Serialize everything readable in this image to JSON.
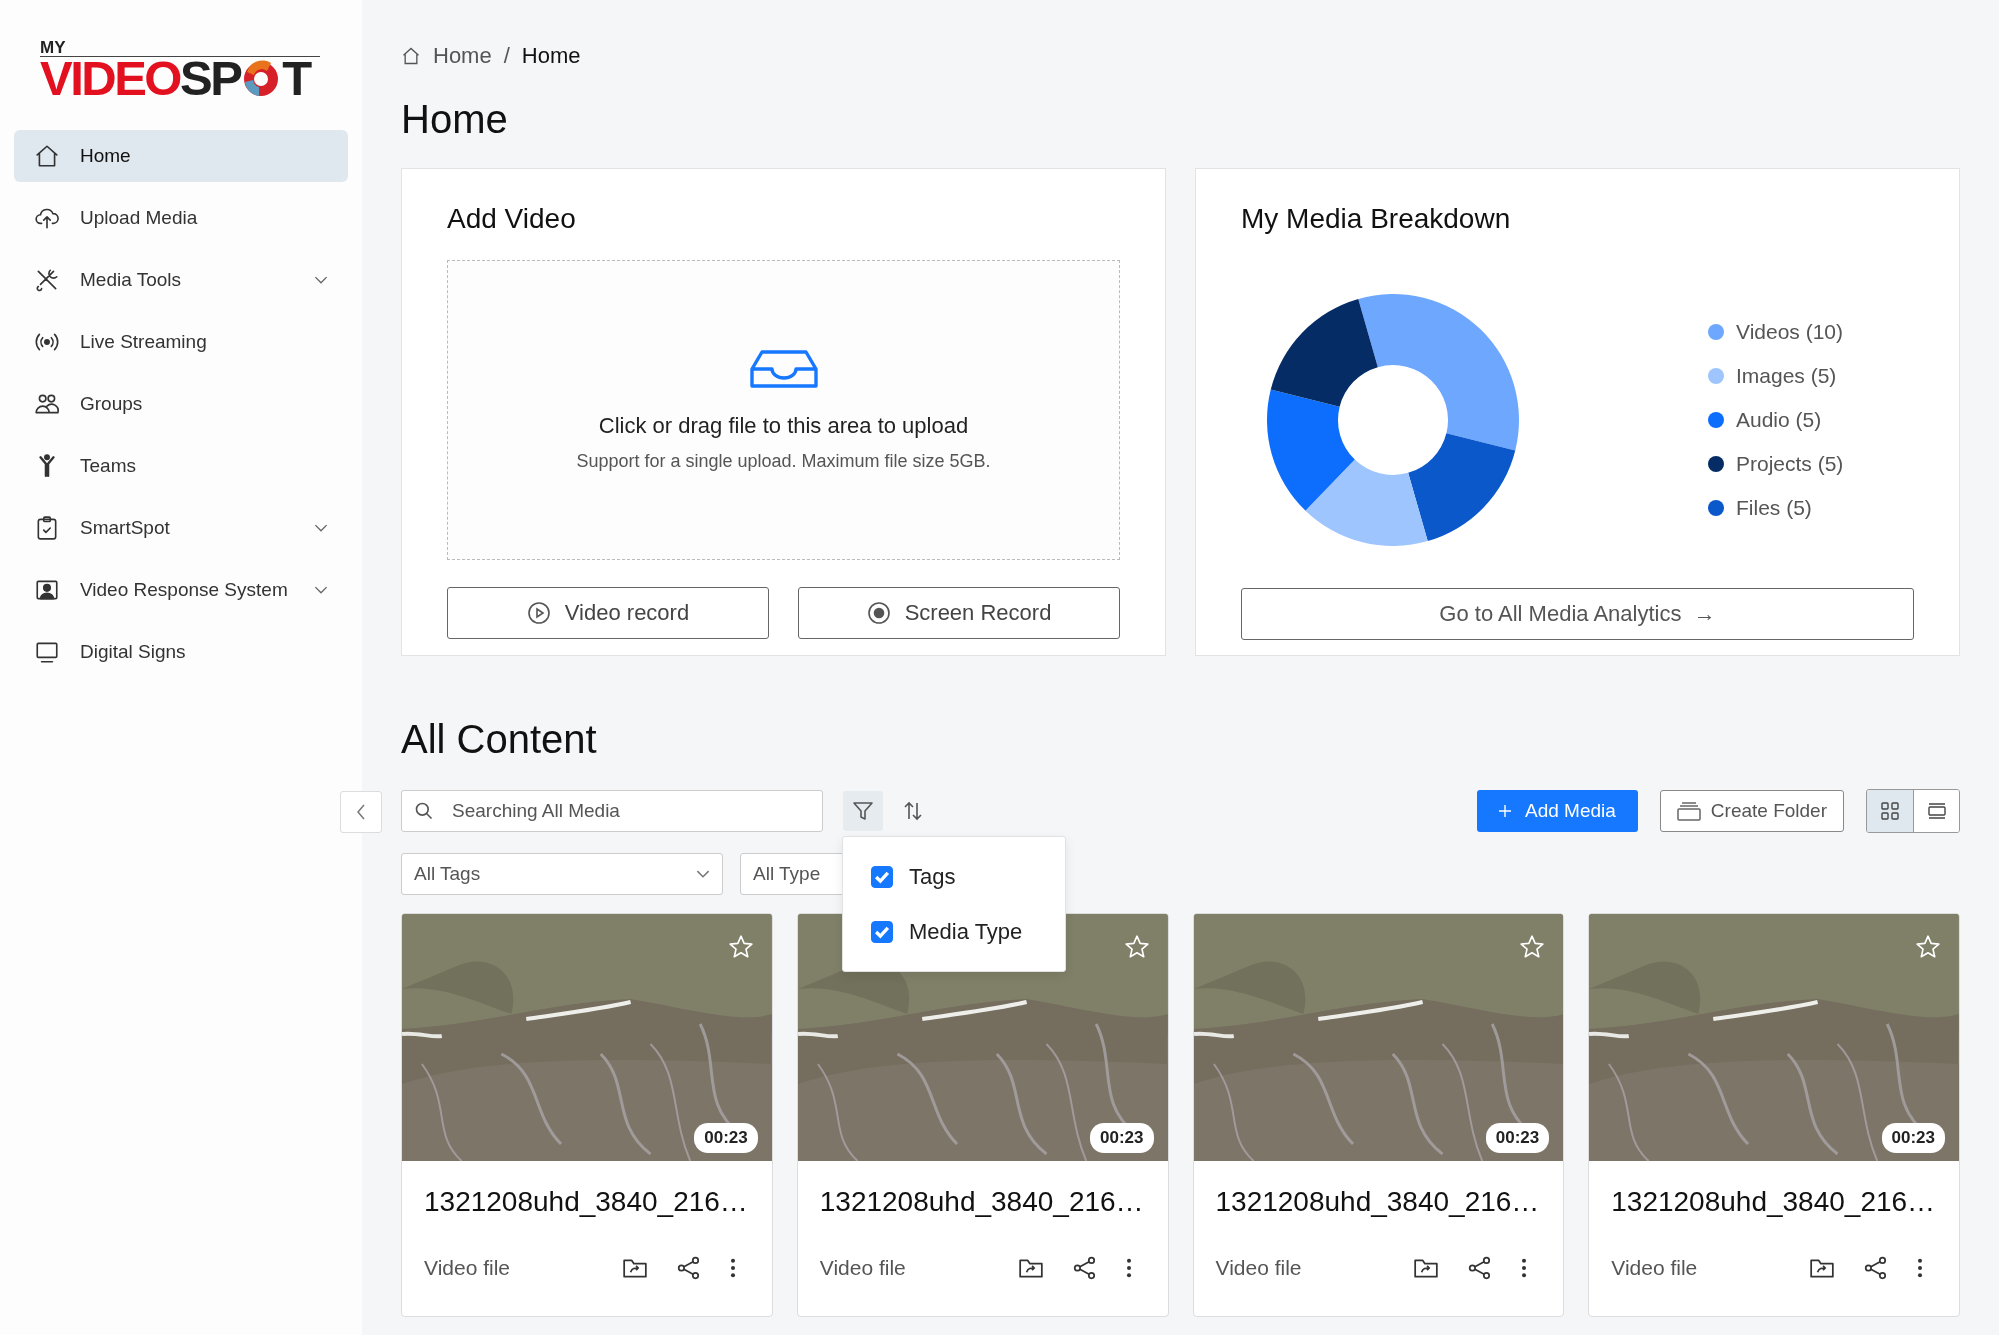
{
  "logo": {
    "top": "MY",
    "wordmark_red": "VIDEO",
    "wordmark_dark": "SP",
    "last": "T"
  },
  "sidebar": {
    "items": [
      {
        "label": "Home",
        "selected": true,
        "expandable": false
      },
      {
        "label": "Upload Media",
        "selected": false,
        "expandable": false
      },
      {
        "label": "Media Tools",
        "selected": false,
        "expandable": true
      },
      {
        "label": "Live Streaming",
        "selected": false,
        "expandable": false
      },
      {
        "label": "Groups",
        "selected": false,
        "expandable": false
      },
      {
        "label": "Teams",
        "selected": false,
        "expandable": false
      },
      {
        "label": "SmartSpot",
        "selected": false,
        "expandable": true
      },
      {
        "label": "Video Response System",
        "selected": false,
        "expandable": true
      },
      {
        "label": "Digital Signs",
        "selected": false,
        "expandable": false
      }
    ]
  },
  "breadcrumb": {
    "items": [
      "Home",
      "Home"
    ],
    "separator": "/"
  },
  "page_title": "Home",
  "add_video": {
    "title": "Add Video",
    "dropzone": {
      "title": "Click or drag file to this area to upload",
      "hint": "Support for a single upload. Maximum file size 5GB."
    },
    "buttons": [
      {
        "label": "Video record"
      },
      {
        "label": "Screen Record"
      }
    ]
  },
  "breakdown": {
    "title": "My Media Breakdown",
    "chart_data": {
      "type": "donut",
      "categories": [
        "Videos (10)",
        "Images (5)",
        "Audio (5)",
        "Projects (5)",
        "Files (5)"
      ],
      "values": [
        10,
        5,
        5,
        5,
        5
      ],
      "colors": [
        "#6ea8fe",
        "#9ec5fe",
        "#0d6efd",
        "#052c65",
        "#0a58ca"
      ]
    },
    "button": {
      "label": "Go to All Media Analytics",
      "arrow": "→"
    }
  },
  "content": {
    "title": "All Content",
    "search": {
      "placeholder": "Searching All Media"
    },
    "filter_active": true,
    "add_button": "Add Media",
    "folder_button": "Create Folder",
    "view_modes": [
      {
        "kind": "grid",
        "selected": true
      },
      {
        "kind": "list",
        "selected": false
      }
    ],
    "filters": [
      {
        "placeholder": "All Tags"
      },
      {
        "placeholder": "All Type"
      }
    ],
    "filter_menu": {
      "items": [
        {
          "label": "Tags",
          "checked": true
        },
        {
          "label": "Media Type",
          "checked": true
        }
      ]
    },
    "items": [
      {
        "title": "1321208uhd_3840_216…",
        "type": "Video file",
        "duration": "00:23",
        "favorite": false
      },
      {
        "title": "1321208uhd_3840_216…",
        "type": "Video file",
        "duration": "00:23",
        "favorite": false
      },
      {
        "title": "1321208uhd_3840_216…",
        "type": "Video file",
        "duration": "00:23",
        "favorite": false
      },
      {
        "title": "1321208uhd_3840_216…",
        "type": "Video file",
        "duration": "00:23",
        "favorite": false
      }
    ]
  }
}
